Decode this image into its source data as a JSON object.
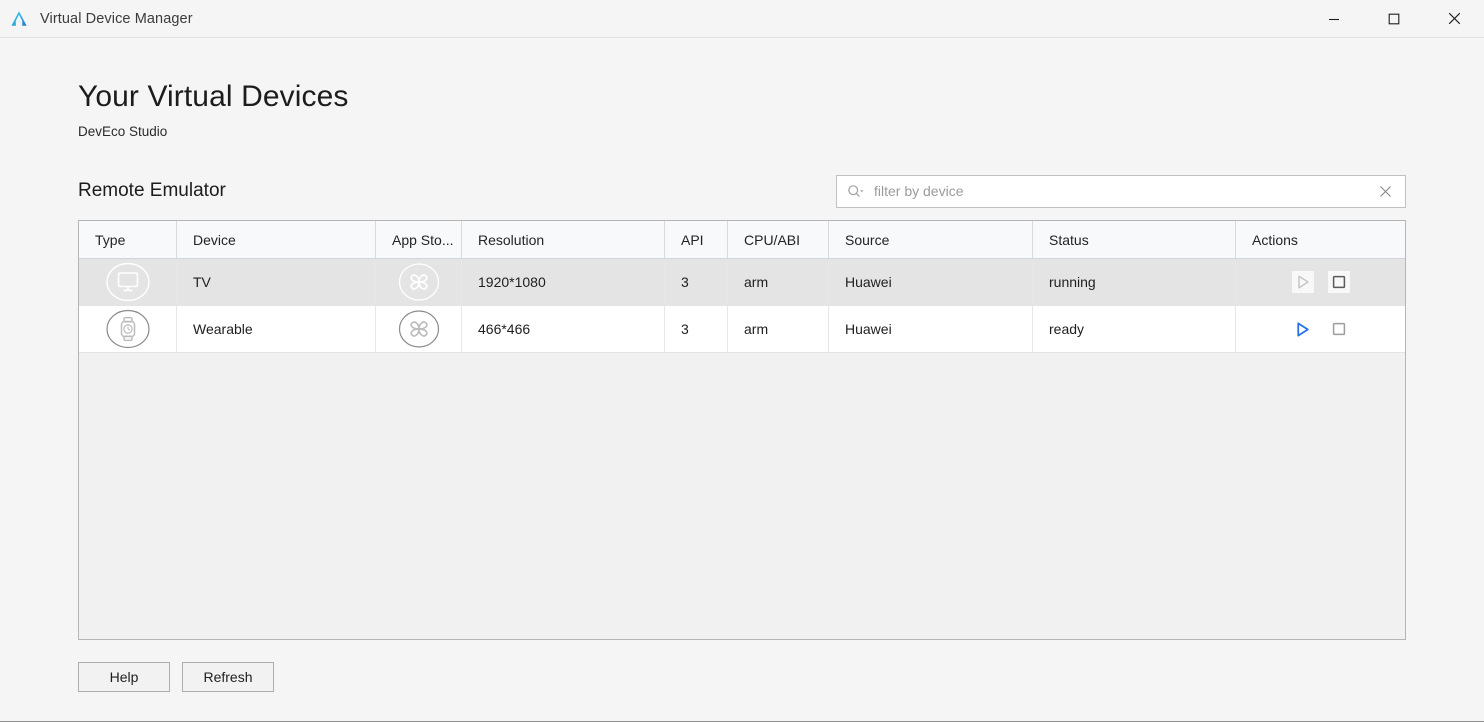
{
  "window": {
    "title": "Virtual Device Manager",
    "app_icon": "deveco-triangle-icon",
    "controls": {
      "minimize": "minimize-icon",
      "maximize": "maximize-icon",
      "close": "close-icon"
    }
  },
  "page": {
    "title": "Your Virtual Devices",
    "subtitle": "DevEco Studio",
    "section_title": "Remote Emulator"
  },
  "search": {
    "placeholder": "filter by device",
    "value": "",
    "icon": "search-icon",
    "clear_icon": "close-icon"
  },
  "table": {
    "columns": [
      {
        "key": "type",
        "label": "Type"
      },
      {
        "key": "device",
        "label": "Device"
      },
      {
        "key": "app_store",
        "label": "App Sto..."
      },
      {
        "key": "resolution",
        "label": "Resolution"
      },
      {
        "key": "api",
        "label": "API"
      },
      {
        "key": "cpu_abi",
        "label": "CPU/ABI"
      },
      {
        "key": "source",
        "label": "Source"
      },
      {
        "key": "status",
        "label": "Status"
      },
      {
        "key": "actions",
        "label": "Actions"
      }
    ],
    "rows": [
      {
        "selected": true,
        "type_icon": "tv-icon",
        "device": "TV",
        "app_store_icon": "app-store-flower-icon",
        "resolution": "1920*1080",
        "api": "3",
        "cpu_abi": "arm",
        "source": "Huawei",
        "status": "running",
        "actions": {
          "play": {
            "icon": "play-icon",
            "state": "disabled",
            "color": "#c6c6c6"
          },
          "stop": {
            "icon": "stop-icon",
            "state": "enabled",
            "color": "#5a5a5a"
          }
        }
      },
      {
        "selected": false,
        "type_icon": "watch-icon",
        "device": "Wearable",
        "app_store_icon": "app-store-flower-icon",
        "resolution": "466*466",
        "api": "3",
        "cpu_abi": "arm",
        "source": "Huawei",
        "status": "ready",
        "actions": {
          "play": {
            "icon": "play-icon",
            "state": "enabled",
            "color": "#2a72e8"
          },
          "stop": {
            "icon": "stop-icon",
            "state": "disabled",
            "color": "#9d9d9d"
          }
        }
      }
    ]
  },
  "footer": {
    "help_label": "Help",
    "refresh_label": "Refresh"
  },
  "colors": {
    "accent_blue": "#2a72e8",
    "window_bg": "#f5f5f5",
    "header_bg": "#f7f9fb",
    "row_selected_bg": "#e4e4e4",
    "table_empty_bg": "#f1f1f1",
    "icon_gray": "#bdbdbd",
    "icon_dark_gray": "#8a8a8a"
  }
}
